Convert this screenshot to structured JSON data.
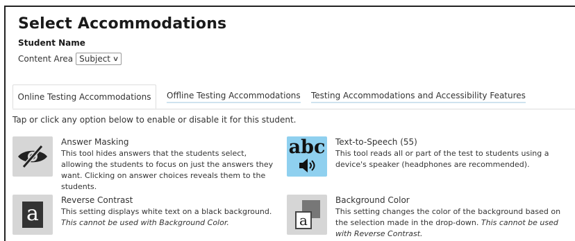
{
  "header": {
    "title": "Select Accommodations",
    "student_name": "Student Name",
    "content_area_label": "Content Area",
    "content_area_value": "Subject"
  },
  "tabs": [
    {
      "label": "Online Testing Accommodations",
      "active": true
    },
    {
      "label": "Offline Testing Accommodations",
      "active": false
    },
    {
      "label": "Testing Accommodations and Accessibility Features",
      "active": false
    }
  ],
  "intro": "Tap or click any option below to enable or disable it for this student.",
  "accommodations": [
    {
      "name": "Answer Masking",
      "icon": "eye-slash-icon",
      "description": "This tool hides answers that the students select, allowing the students to focus on just the answers they want. Clicking on answer choices reveals them to the students.",
      "note": "",
      "enabled": false
    },
    {
      "name": "Text-to-Speech (55)",
      "icon": "text-to-speech-icon",
      "icon_text": "abc",
      "description": "This tool reads all or part of the test to students using a device's speaker (headphones are recommended).",
      "note": "",
      "enabled": true
    },
    {
      "name": "Reverse Contrast",
      "icon": "reverse-contrast-icon",
      "icon_text": "a",
      "description": "This setting displays white text on a black background.",
      "note": "This cannot be used with Background Color.",
      "enabled": false
    },
    {
      "name": "Background Color",
      "icon": "background-color-icon",
      "icon_text": "a",
      "description": "This setting changes the color of the background based on the selection made in the drop-down.",
      "note": "This cannot be used with Reverse Contrast.",
      "enabled": false
    }
  ],
  "colors": {
    "enabled_icon_bg": "#8fd0ef",
    "disabled_icon_bg": "#d6d6d6",
    "tab_underline": "#cfe3ef"
  }
}
